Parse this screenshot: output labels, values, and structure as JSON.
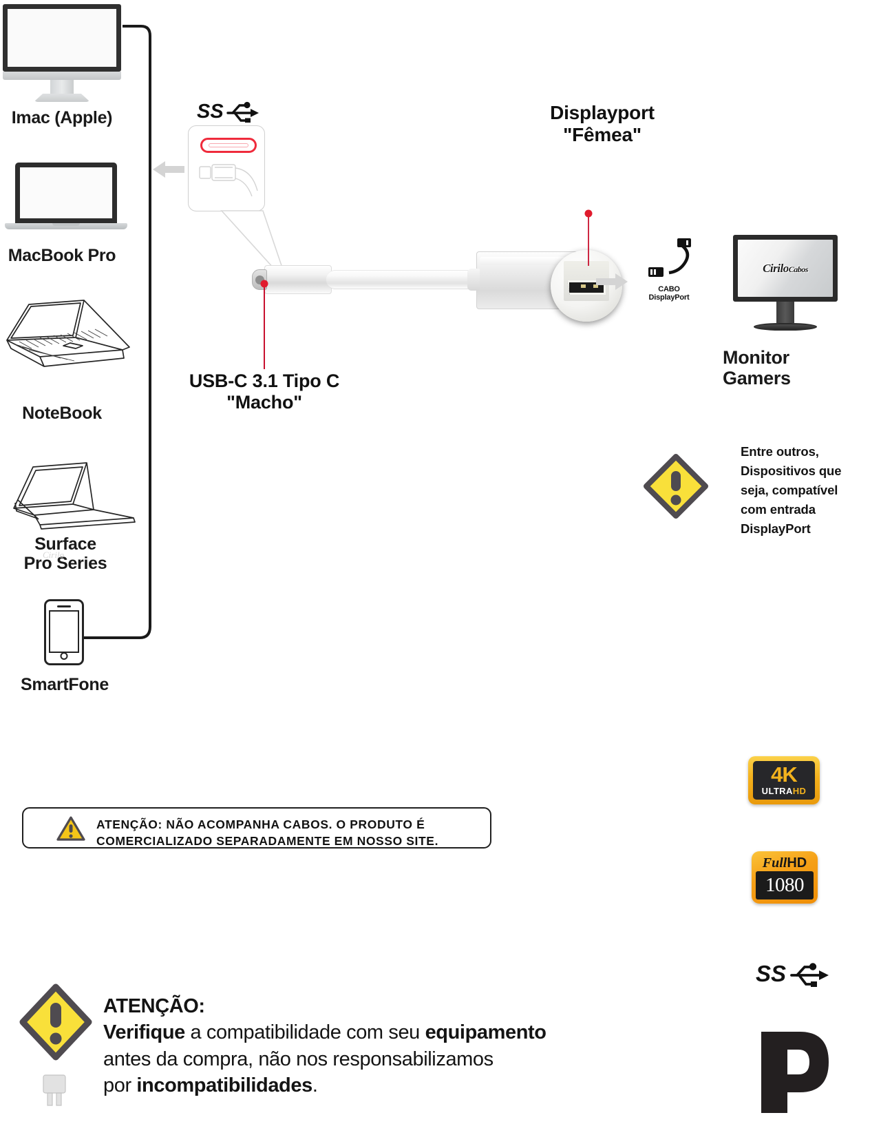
{
  "devices": [
    {
      "id": "imac",
      "label": "Imac (Apple)"
    },
    {
      "id": "macbook",
      "label": "MacBook Pro"
    },
    {
      "id": "notebook",
      "label": "NoteBook"
    },
    {
      "id": "surface",
      "label": "Surface\nPro Series"
    },
    {
      "id": "phone",
      "label": "SmartFone"
    }
  ],
  "output_device": {
    "label": "Monitor\nGamers",
    "screen_logo": "Cirilo",
    "screen_logo_sub": "Cabos"
  },
  "connectors": {
    "usbc": {
      "title": "USB-C 3.1 Tipo C\n\"Macho\"",
      "badge_icon": "usb-superspeed-icon"
    },
    "displayport": {
      "title": "Displayport\n\"Fêmea\""
    },
    "cable_note": "CABO\nDisplayPort"
  },
  "side_note": {
    "icon": "warning-diamond-icon",
    "text": "Entre outros,\nDispositivos que\nseja, compatível\ncom entrada\nDisplayPort"
  },
  "notice_box": {
    "icon": "warning-triangle-icon",
    "strong": "ATENÇÃO",
    "line1_rest": ": NÃO ACOMPANHA CABOS. O PRODUTO É",
    "line2": "COMERCIALIZADO SEPARADAMENTE EM NOSSO SITE."
  },
  "attention": {
    "icon": "warning-diamond-icon",
    "heading": "ATENÇÃO:",
    "l1_b1": "Verifique",
    "l1_mid": " a compatibilidade com seu ",
    "l1_b2": "equipamento",
    "l2": "antes da compra, não nos responsabilizamos",
    "l3_pre": "por ",
    "l3_b": "incompatibilidades",
    "l3_post": "."
  },
  "badges": {
    "fourk": {
      "main": "4K",
      "sub_white": "ULTRA",
      "sub_yellow": "HD"
    },
    "fullhd": {
      "top_italic": "Full",
      "top_bold": "HD",
      "num": "1080"
    },
    "usb_ss": "usb-superspeed-icon",
    "displayport_logo": "displayport-logo-icon"
  },
  "colors": {
    "accent_red": "#ef2b3c",
    "warning_yellow": "#f9e03a",
    "warning_stroke": "#4f4b50",
    "badge_gold": "#f3b21d",
    "line_dark": "#1a1a1a"
  }
}
